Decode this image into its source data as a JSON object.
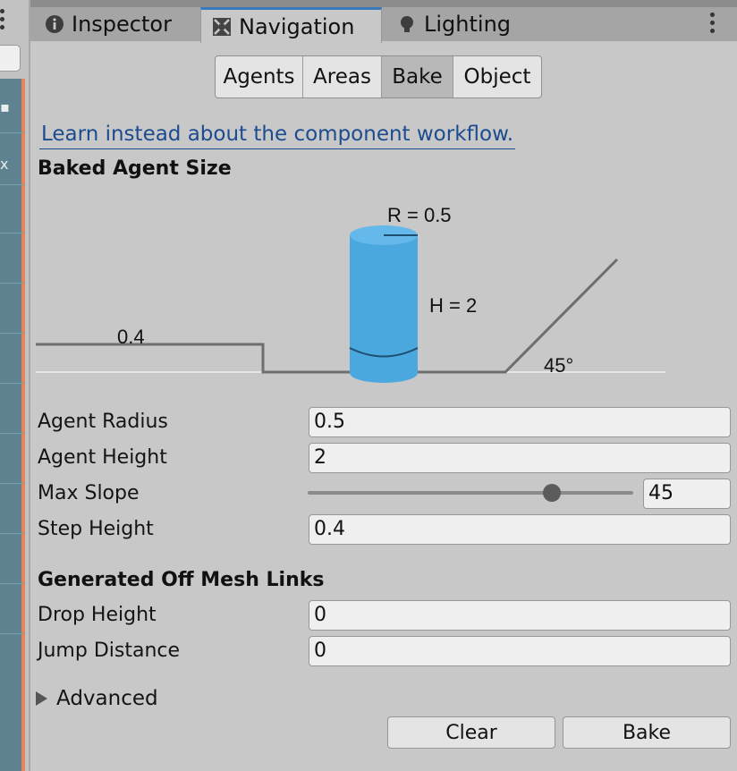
{
  "tabs": [
    {
      "label": "Inspector",
      "icon": "info-icon"
    },
    {
      "label": "Navigation",
      "icon": "navigation-icon"
    },
    {
      "label": "Lighting",
      "icon": "lightbulb-icon"
    }
  ],
  "active_tab": "Navigation",
  "subtabs": [
    "Agents",
    "Areas",
    "Bake",
    "Object"
  ],
  "active_subtab": "Bake",
  "component_link": "Learn instead about the component workflow.",
  "baked_agent_size": {
    "title": "Baked Agent Size",
    "diagram": {
      "radius_label": "R = 0.5",
      "height_label": "H = 2",
      "step_label": "0.4",
      "slope_label": "45°"
    },
    "fields": {
      "agent_radius": {
        "label": "Agent Radius",
        "value": "0.5"
      },
      "agent_height": {
        "label": "Agent Height",
        "value": "2"
      },
      "max_slope": {
        "label": "Max Slope",
        "value": "45",
        "slider_fraction": 0.75
      },
      "step_height": {
        "label": "Step Height",
        "value": "0.4"
      }
    }
  },
  "off_mesh_links": {
    "title": "Generated Off Mesh Links",
    "drop_height": {
      "label": "Drop Height",
      "value": "0"
    },
    "jump_distance": {
      "label": "Jump Distance",
      "value": "0"
    }
  },
  "advanced_label": "Advanced",
  "buttons": {
    "clear": "Clear",
    "bake": "Bake"
  },
  "colors": {
    "accent": "#3a79bb",
    "link": "#1c4c8f",
    "agent": "#4aa8df"
  }
}
